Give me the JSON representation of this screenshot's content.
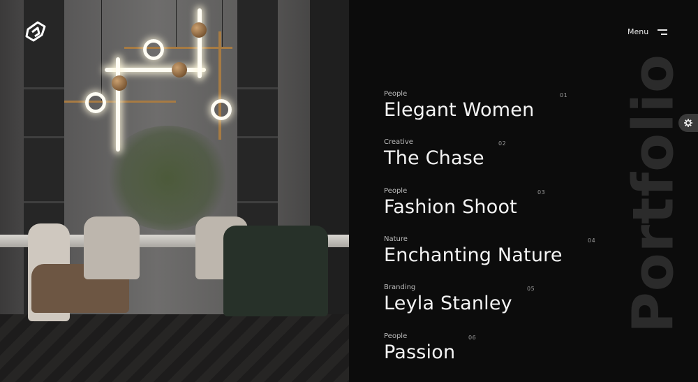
{
  "header": {
    "menu_label": "Menu",
    "logo_icon": "logo-icon",
    "menu_icon": "hamburger-icon"
  },
  "background_word": "Portfolio",
  "settings_icon": "gear-icon",
  "portfolio": [
    {
      "category": "People",
      "title": "Elegant Women",
      "number": "01"
    },
    {
      "category": "Creative",
      "title": "The Chase",
      "number": "02"
    },
    {
      "category": "People",
      "title": "Fashion Shoot",
      "number": "03"
    },
    {
      "category": "Nature",
      "title": "Enchanting Nature",
      "number": "04"
    },
    {
      "category": "Branding",
      "title": "Leyla Stanley",
      "number": "05"
    },
    {
      "category": "People",
      "title": "Passion",
      "number": "06"
    }
  ],
  "colors": {
    "background": "#0c0c0c",
    "text": "#f4f4f4",
    "muted": "#bdbdbd",
    "ghost_word": "#2b2b2b"
  }
}
